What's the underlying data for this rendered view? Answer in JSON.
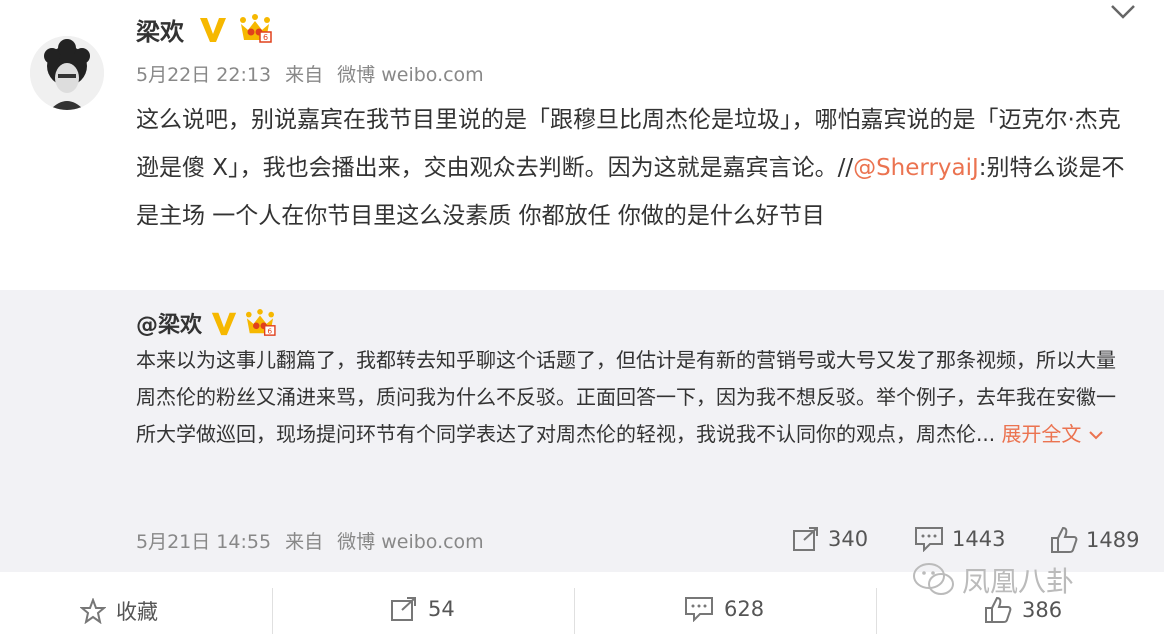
{
  "post": {
    "author": "梁欢",
    "date": "5月22日 22:13",
    "from_label": "来自",
    "source": "微博 weibo.com",
    "text_main": "这么说吧，别说嘉宾在我节目里说的是「跟穆旦比周杰伦是垃圾」，哪怕嘉宾说的是「迈克尔·杰克逊是傻 X」，我也会播出来，交由观众去判断。因为这就是嘉宾言论。//",
    "mention": "@SherryaiJ",
    "text_tail": ":别特么谈是不是主场 一个人在你节目里这么没素质 你都放任 你做的是什么好节目"
  },
  "quoted": {
    "author": "@梁欢",
    "text": "本来以为这事儿翻篇了，我都转去知乎聊这个话题了，但估计是有新的营销号或大号又发了那条视频，所以大量周杰伦的粉丝又涌进来骂，质问我为什么不反驳。正面回答一下，因为我不想反驳。举个例子，去年我在安徽一所大学做巡回，现场提问环节有个同学表达了对周杰伦的轻视，我说我不认同你的观点，周杰伦...",
    "expand_label": "展开全文",
    "date": "5月21日 14:55",
    "from_label": "来自",
    "source": "微博 weibo.com",
    "reposts": "340",
    "comments": "1443",
    "likes": "1489"
  },
  "footer": {
    "favorite_label": "收藏",
    "reposts": "54",
    "comments": "628",
    "likes": "386"
  },
  "watermark": "凤凰八卦",
  "colors": {
    "accent": "#eb7350",
    "vip_badge": "#f6b800",
    "crown": "#f6b800",
    "quote_bg": "#f2f2f5"
  },
  "icons": [
    "avatar",
    "verified-v-icon",
    "crown-icon",
    "chevron-down-icon",
    "repost-icon",
    "comment-icon",
    "like-icon",
    "star-icon",
    "wechat-icon"
  ]
}
